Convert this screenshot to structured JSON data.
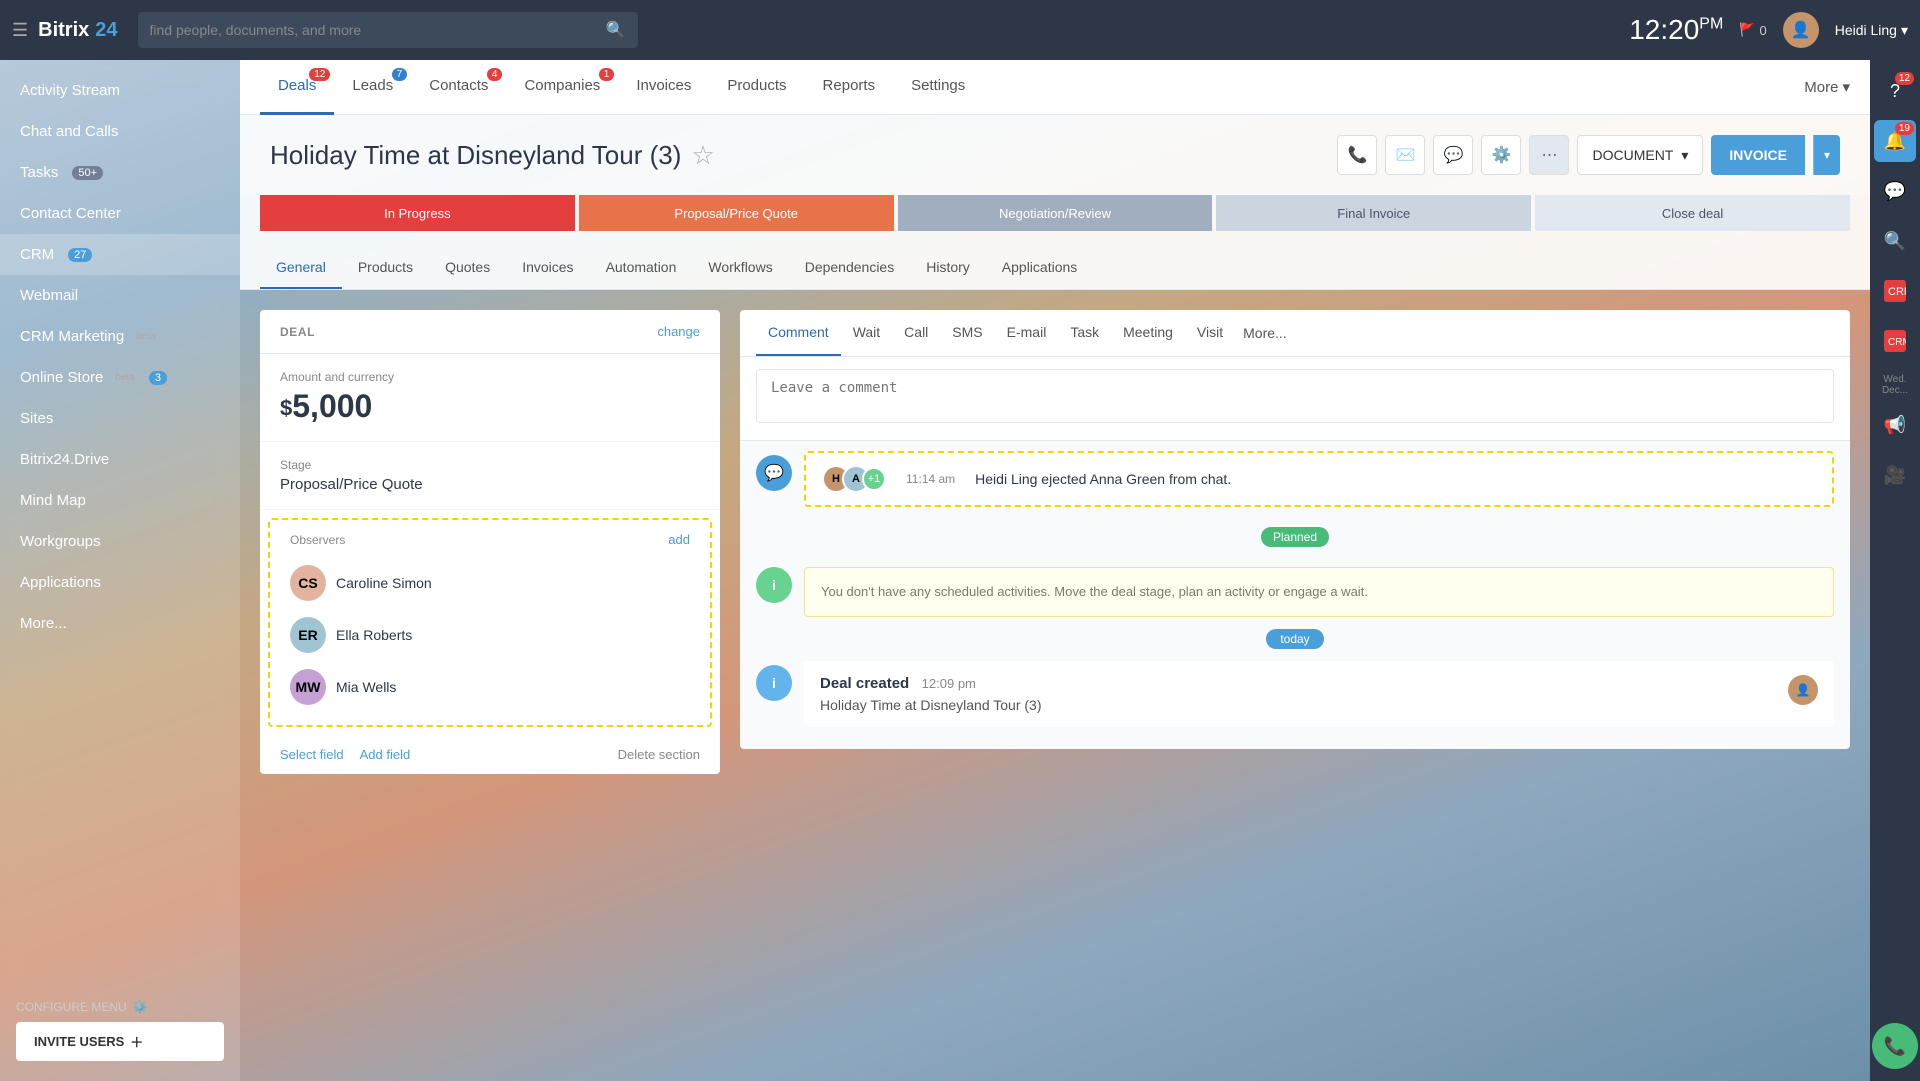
{
  "app": {
    "title": "Bitrix",
    "title_accent": "24",
    "logo_icon": "grid-icon"
  },
  "topbar": {
    "search_placeholder": "find people, documents, and more",
    "time": "12:20",
    "time_period": "PM",
    "flag_text": "0",
    "user_name": "Heidi Ling",
    "help_label": "?"
  },
  "right_sidebar": {
    "help_badge": "12",
    "notification_badge": "19"
  },
  "left_sidebar": {
    "items": [
      {
        "id": "activity-stream",
        "label": "Activity Stream"
      },
      {
        "id": "chat-and-calls",
        "label": "Chat and Calls"
      },
      {
        "id": "tasks",
        "label": "Tasks",
        "badge": "50+",
        "badge_type": "gray"
      },
      {
        "id": "contact-center",
        "label": "Contact Center"
      },
      {
        "id": "crm",
        "label": "CRM",
        "badge": "27",
        "badge_type": "blue",
        "active": true
      },
      {
        "id": "webmail",
        "label": "Webmail"
      },
      {
        "id": "crm-marketing",
        "label": "CRM Marketing",
        "suffix": "beta"
      },
      {
        "id": "online-store",
        "label": "Online Store",
        "suffix": "beta",
        "badge": "3"
      },
      {
        "id": "sites",
        "label": "Sites"
      },
      {
        "id": "bitrix24-drive",
        "label": "Bitrix24.Drive"
      },
      {
        "id": "mind-map",
        "label": "Mind Map"
      },
      {
        "id": "workgroups",
        "label": "Workgroups"
      },
      {
        "id": "applications",
        "label": "Applications"
      },
      {
        "id": "more",
        "label": "More..."
      }
    ],
    "configure_menu": "CONFIGURE MENU",
    "invite_users": "INVITE USERS"
  },
  "nav_tabs": [
    {
      "id": "deals",
      "label": "Deals",
      "badge": "12",
      "badge_type": "red",
      "active": true
    },
    {
      "id": "leads",
      "label": "Leads",
      "badge": "7",
      "badge_type": "blue"
    },
    {
      "id": "contacts",
      "label": "Contacts",
      "badge": "4",
      "badge_type": "red"
    },
    {
      "id": "companies",
      "label": "Companies",
      "badge": "1",
      "badge_type": "red"
    },
    {
      "id": "invoices",
      "label": "Invoices"
    },
    {
      "id": "products",
      "label": "Products"
    },
    {
      "id": "reports",
      "label": "Reports"
    },
    {
      "id": "settings",
      "label": "Settings"
    },
    {
      "id": "more",
      "label": "More"
    }
  ],
  "deal": {
    "title": "Holiday Time at Disneyland Tour (3)",
    "count": "(3)",
    "stages": [
      {
        "id": "in-progress",
        "label": "In Progress",
        "type": "red"
      },
      {
        "id": "proposal",
        "label": "Proposal/Price Quote",
        "type": "orange"
      },
      {
        "id": "negotiation",
        "label": "Negotiation/Review",
        "type": "gray"
      },
      {
        "id": "final-invoice",
        "label": "Final Invoice",
        "type": "gray-light"
      },
      {
        "id": "close-deal",
        "label": "Close deal",
        "type": "white"
      }
    ],
    "sub_tabs": [
      {
        "id": "general",
        "label": "General",
        "active": true
      },
      {
        "id": "products",
        "label": "Products"
      },
      {
        "id": "quotes",
        "label": "Quotes"
      },
      {
        "id": "invoices",
        "label": "Invoices"
      },
      {
        "id": "automation",
        "label": "Automation"
      },
      {
        "id": "workflows",
        "label": "Workflows"
      },
      {
        "id": "dependencies",
        "label": "Dependencies"
      },
      {
        "id": "history",
        "label": "History"
      },
      {
        "id": "applications",
        "label": "Applications"
      }
    ],
    "panel_title": "DEAL",
    "change_link": "change",
    "amount_label": "Amount and currency",
    "amount_symbol": "$",
    "amount_value": "5,000",
    "stage_label": "Stage",
    "stage_value": "Proposal/Price Quote",
    "observers_label": "Observers",
    "add_link": "add",
    "observers": [
      {
        "id": "caroline-simon",
        "name": "Caroline Simon",
        "initials": "CS",
        "color": "#e2b4a0"
      },
      {
        "id": "ella-roberts",
        "name": "Ella Roberts",
        "initials": "ER",
        "color": "#a0c4d4"
      },
      {
        "id": "mia-wells",
        "name": "Mia Wells",
        "initials": "MW",
        "color": "#c4a0d4"
      }
    ],
    "select_field": "Select field",
    "add_field": "Add field",
    "delete_section": "Delete section",
    "document_btn": "DOCUMENT",
    "invoice_btn": "INVOICE"
  },
  "activity": {
    "comment_tabs": [
      {
        "id": "comment",
        "label": "Comment",
        "active": true
      },
      {
        "id": "wait",
        "label": "Wait"
      },
      {
        "id": "call",
        "label": "Call"
      },
      {
        "id": "sms",
        "label": "SMS"
      },
      {
        "id": "email",
        "label": "E-mail"
      },
      {
        "id": "task",
        "label": "Task"
      },
      {
        "id": "meeting",
        "label": "Meeting"
      },
      {
        "id": "visit",
        "label": "Visit"
      },
      {
        "id": "more",
        "label": "More..."
      }
    ],
    "comment_placeholder": "Leave a comment",
    "ejected_time": "11:14 am",
    "ejected_text": "Heidi Ling ejected Anna Green from chat.",
    "ejected_plus": "+1",
    "planned_label": "Planned",
    "no_activities_text": "You don't have any scheduled activities. Move the deal stage, plan an activity or engage a wait.",
    "today_label": "today",
    "deal_created_label": "Deal created",
    "deal_created_time": "12:09 pm",
    "deal_created_name": "Holiday Time at Disneyland Tour (3)"
  }
}
